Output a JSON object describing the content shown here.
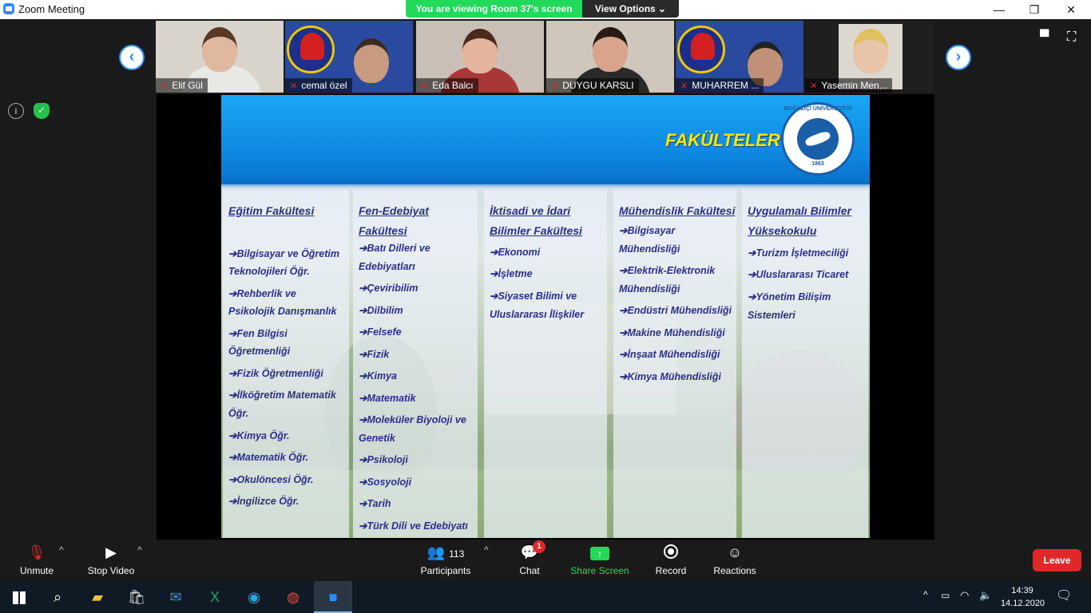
{
  "window": {
    "title": "Zoom Meeting",
    "minimize": "—",
    "restore": "❐",
    "close": "✕"
  },
  "banner": {
    "text": "You are viewing Room 37's screen",
    "options": "View Options ⌄"
  },
  "gallery": {
    "prev": "‹",
    "next": "›",
    "participants": [
      {
        "name": "Elif Gül"
      },
      {
        "name": "cemal özel"
      },
      {
        "name": "Eda Balcı"
      },
      {
        "name": "DUYGU KARSLI"
      },
      {
        "name": "MUHARREM ..."
      },
      {
        "name": "Yasemin Men..."
      }
    ],
    "mic_icon": "✕"
  },
  "side": {
    "info": "i",
    "shield": "✓"
  },
  "top_right": {
    "layout": "▀",
    "fullscreen": "⛶"
  },
  "slide": {
    "title": "FAKÜLTELER",
    "seal_text": "BOĞAZİÇİ ÜNİVERSİTESİ",
    "seal_year": "1863",
    "columns": [
      {
        "title_lines": [
          "Eğitim Fakültesi"
        ],
        "items": [
          "➔Bilgisayar ve Öğretim",
          "Teknolojileri Öğr.",
          "➔Rehberlik ve",
          "Psikolojik Danışmanlık",
          "➔Fen Bilgisi",
          "Öğretmenliği",
          "➔Fizik Öğretmenliği",
          "➔İlköğretim Matematik",
          "Öğr.",
          "➔Kimya Öğr.",
          "➔Matematik Öğr.",
          "➔Okulöncesi Öğr.",
          "➔İngilizce Öğr."
        ]
      },
      {
        "title_lines": [
          "Fen-Edebiyat",
          "Fakültesi"
        ],
        "items": [
          "➔Batı Dilleri ve",
          "Edebiyatları",
          "➔Çeviribilim",
          "➔Dilbilim",
          "➔Felsefe",
          "➔Fizik",
          "➔Kimya",
          "➔Matematik",
          "➔Moleküler Biyoloji ve",
          "Genetik",
          "➔Psikoloji",
          "➔Sosyoloji",
          "➔Tarih",
          "➔Türk Dili ve Edebiyatı"
        ]
      },
      {
        "title_lines": [
          "İktisadi ve İdari",
          "Bilimler Fakültesi"
        ],
        "items": [
          "➔Ekonomi",
          "➔İşletme",
          "➔Siyaset Bilimi ve",
          "Uluslararası İlişkiler"
        ]
      },
      {
        "title_lines": [
          "Mühendislik Fakültesi"
        ],
        "items": [
          "➔Bilgisayar",
          "Mühendisliği",
          "➔Elektrik-Elektronik",
          "Mühendisliği",
          "➔Endüstri Mühendisliği",
          "➔Makine Mühendisliği",
          "➔İnşaat Mühendisliği",
          "➔Kimya Mühendisliği"
        ]
      },
      {
        "title_lines": [
          "Uygulamalı Bilimler",
          "Yüksekokulu"
        ],
        "items": [
          "➔Turizm İşletmeciliği",
          "➔Uluslararası Ticaret",
          "➔Yönetim Bilişim",
          "Sistemleri"
        ]
      }
    ]
  },
  "toolbar": {
    "unmute": "Unmute",
    "stop_video": "Stop Video",
    "participants": "Participants",
    "participants_count": "113",
    "chat": "Chat",
    "chat_badge": "1",
    "share": "Share Screen",
    "record": "Record",
    "reactions": "Reactions",
    "leave": "Leave",
    "caret": "^"
  },
  "taskbar": {
    "time": "14:39",
    "date": "14.12.2020",
    "tray_up": "^",
    "notifications": "🗨"
  },
  "colors": {
    "accent": "#2d8cff",
    "banner_green": "#23d959",
    "leave_red": "#e02828",
    "slide_text": "#2b2f8a",
    "slide_title": "#f5e800"
  }
}
